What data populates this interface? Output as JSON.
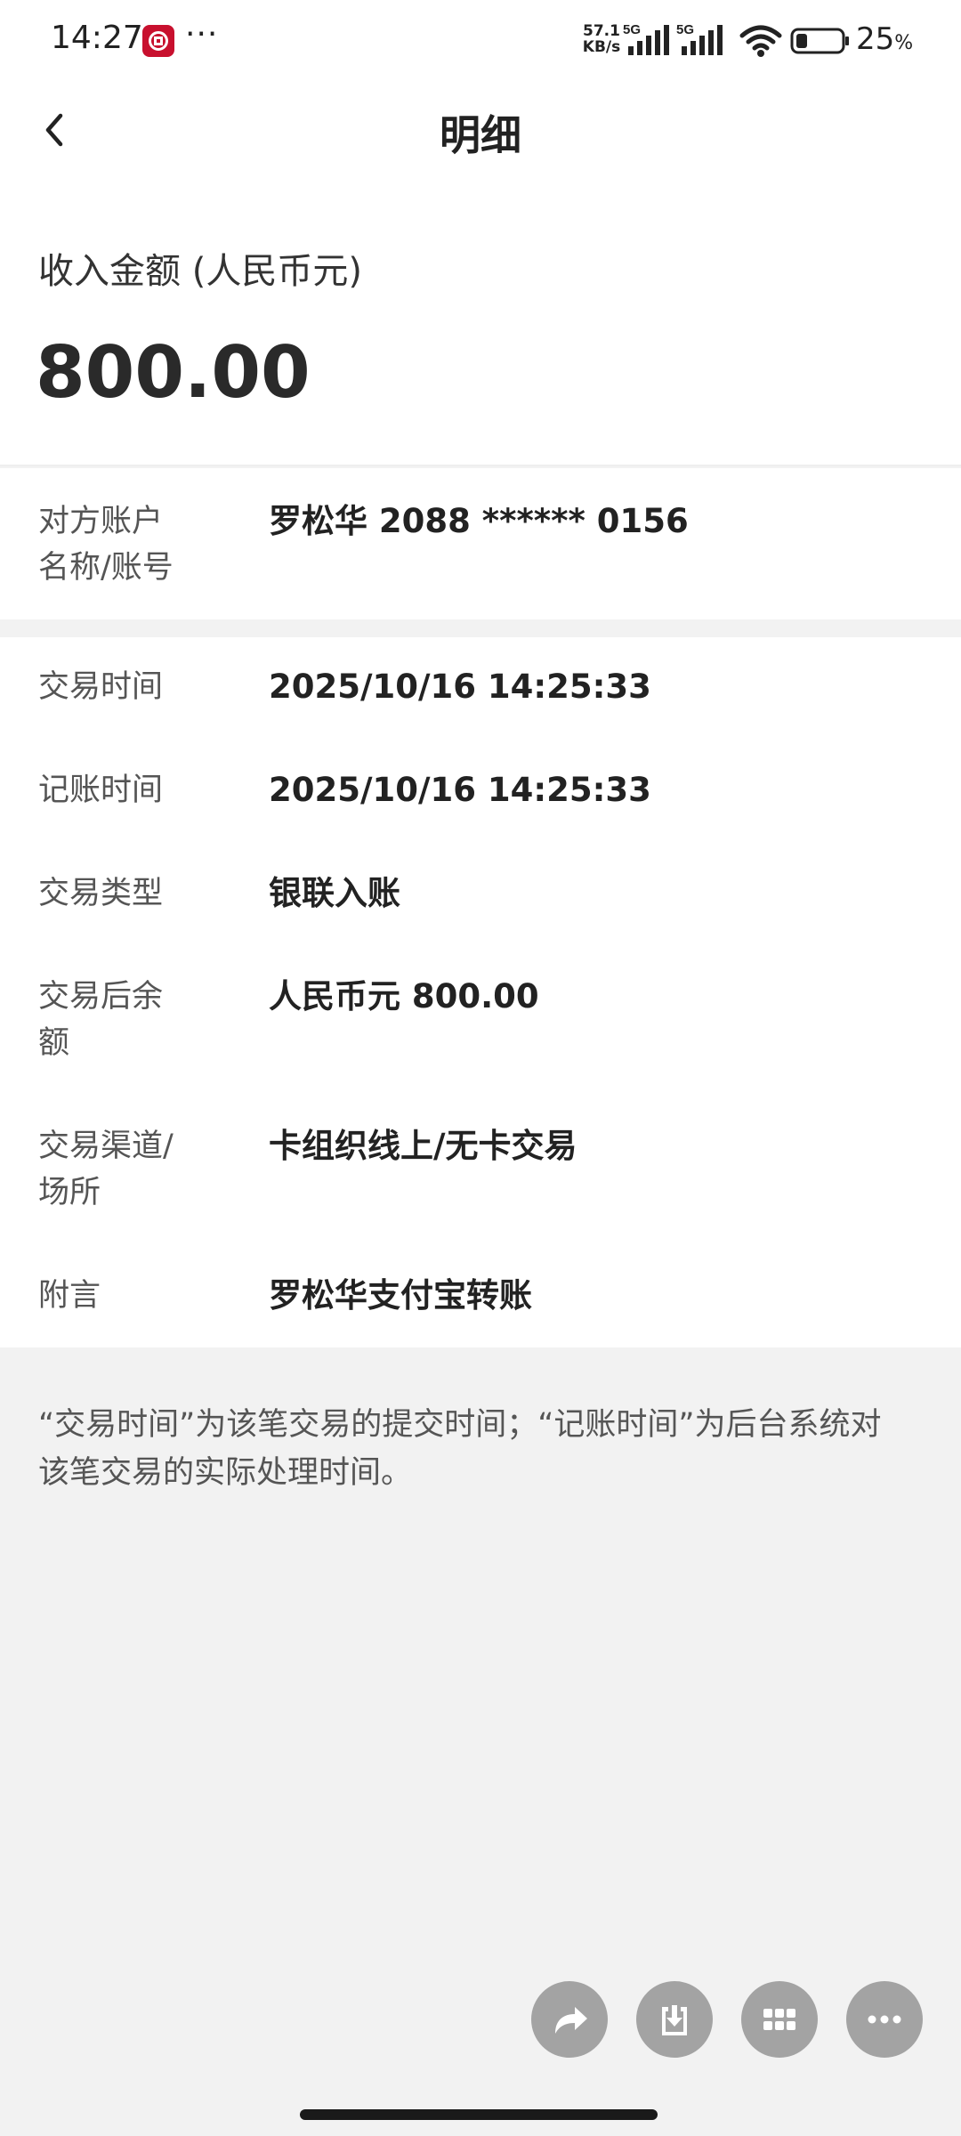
{
  "status_bar": {
    "time": "14:27",
    "dots": "···",
    "net_speed_value": "57.1",
    "net_speed_unit": "KB/s",
    "signal_1_label": "5G",
    "signal_2_label": "5G",
    "battery_percent": "25",
    "battery_percent_sign": "%",
    "battery_level": 0.25
  },
  "header": {
    "title": "明细",
    "back_icon": "chevron-left-icon"
  },
  "amount": {
    "label": "收入金额 (人民币元)",
    "value": "800.00"
  },
  "counterparty": {
    "label_line1": "对方账户",
    "label_line2": "名称/账号",
    "value": "罗松华 2088 ****** 0156"
  },
  "details": [
    {
      "label_line1": "交易时间",
      "label_line2": "",
      "value": "2025/10/16 14:25:33"
    },
    {
      "label_line1": "记账时间",
      "label_line2": "",
      "value": "2025/10/16 14:25:33"
    },
    {
      "label_line1": "交易类型",
      "label_line2": "",
      "value": "银联入账"
    },
    {
      "label_line1": "交易后余",
      "label_line2": "额",
      "value": "人民币元 800.00"
    },
    {
      "label_line1": "交易渠道/",
      "label_line2": "场所",
      "value": "卡组织线上/无卡交易"
    },
    {
      "label_line1": "附言",
      "label_line2": "",
      "value": "罗松华支付宝转账"
    }
  ],
  "footnote": {
    "line1": "“交易时间”为该笔交易的提交时间；“记账时间”为后台系统对",
    "line2": "该笔交易的实际处理时间。"
  },
  "actions": [
    {
      "icon": "share-icon"
    },
    {
      "icon": "download-icon"
    },
    {
      "icon": "grid-icon"
    },
    {
      "icon": "more-icon"
    }
  ],
  "colors": {
    "background": "#f2f2f2",
    "card": "#ffffff",
    "text_primary": "#222222",
    "text_secondary": "#555555",
    "fab": "#a3a3a3",
    "brand": "#c8102e"
  }
}
